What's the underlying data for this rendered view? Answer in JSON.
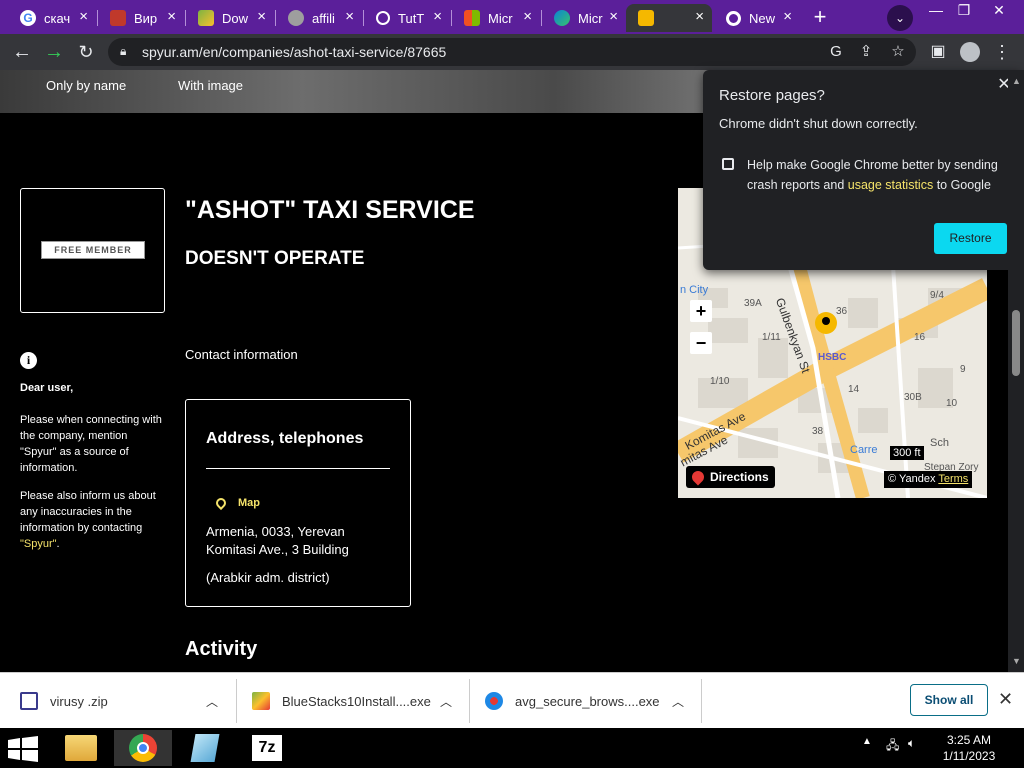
{
  "browser": {
    "tabs": [
      {
        "label": "скач",
        "favicon": "google-icon",
        "color": "#4285f4"
      },
      {
        "label": "Вир",
        "favicon": "site-icon",
        "color": "#c0392b"
      },
      {
        "label": "Dow",
        "favicon": "bluestacks-icon",
        "color": "#7cb342"
      },
      {
        "label": "affili",
        "favicon": "globe-icon",
        "color": "#9e9e9e"
      },
      {
        "label": "TutT",
        "favicon": "gear-icon",
        "color": "#ffffff"
      },
      {
        "label": "Micr",
        "favicon": "microsoft-icon",
        "color": "#f25022"
      },
      {
        "label": "Micr",
        "favicon": "edge-icon",
        "color": "#0c82d6"
      },
      {
        "label": "",
        "favicon": "spyur-icon",
        "color": "#f5b800"
      },
      {
        "label": "New",
        "favicon": "chrome-icon",
        "color": "#ffffff"
      }
    ],
    "active_tab_index": 7,
    "url": "spyur.am/en/companies/ashot-taxi-service/87665"
  },
  "page": {
    "filter_options": [
      "Only by name",
      "With image"
    ],
    "logo_badge": "FREE MEMBER",
    "company_name": "\"ASHOT\" TAXI SERVICE",
    "company_status": "DOESN'T OPERATE",
    "notice": {
      "heading": "Dear user,",
      "para1": "Please when connecting with the company, mention \"Spyur\" as a source of information.",
      "para2_pre": "Please also inform us about any inaccuracies in the information by contacting ",
      "para2_link": "\"Spyur\"",
      "para2_post": "."
    },
    "contact_heading": "Contact information",
    "address_box": {
      "title": "Address, telephones",
      "map_link": "Map",
      "line1": "Armenia, 0033, Yerevan",
      "line2": "Komitasi Ave., 3 Building",
      "line3": "(Arabkir adm. district)"
    },
    "activity_heading": "Activity",
    "map": {
      "zoom_in": "+",
      "zoom_out": "−",
      "labels": {
        "city": "n City",
        "street1": "Gulbenkyan St",
        "street2": "Komitas Ave",
        "street3": "mitas Ave",
        "poi": "HSBC",
        "carre": "Carre",
        "sch": "Sch",
        "stepan": "Stepan Zory",
        "n39a": "39A",
        "n36": "36",
        "n94": "9/4",
        "n111": "1/11",
        "n110": "1/10",
        "n16": "16",
        "n30b": "30B",
        "n38": "38",
        "n14": "14",
        "n10": "10",
        "n9": "9"
      },
      "directions": "Directions",
      "scale": "300 ft",
      "attribution": "© Yandex",
      "terms": "Terms"
    }
  },
  "popup": {
    "title": "Restore pages?",
    "message": "Chrome didn't shut down correctly.",
    "checkbox_pre": "Help make Google Chrome better by sending crash reports and ",
    "checkbox_link": "usage statistics",
    "checkbox_post": " to Google",
    "restore_button": "Restore"
  },
  "downloads": {
    "items": [
      {
        "name": "virusy .zip",
        "icon": "zip-icon"
      },
      {
        "name": "BlueStacks10Install....exe",
        "icon": "bluestacks-icon"
      },
      {
        "name": "avg_secure_brows....exe",
        "icon": "avg-icon"
      }
    ],
    "show_all": "Show all"
  },
  "taskbar": {
    "apps": [
      "file-explorer-icon",
      "chrome-icon",
      "notepad-icon",
      "7zip-icon"
    ],
    "app_7z_label": "7z",
    "time": "3:25 AM",
    "date": "1/11/2023"
  }
}
